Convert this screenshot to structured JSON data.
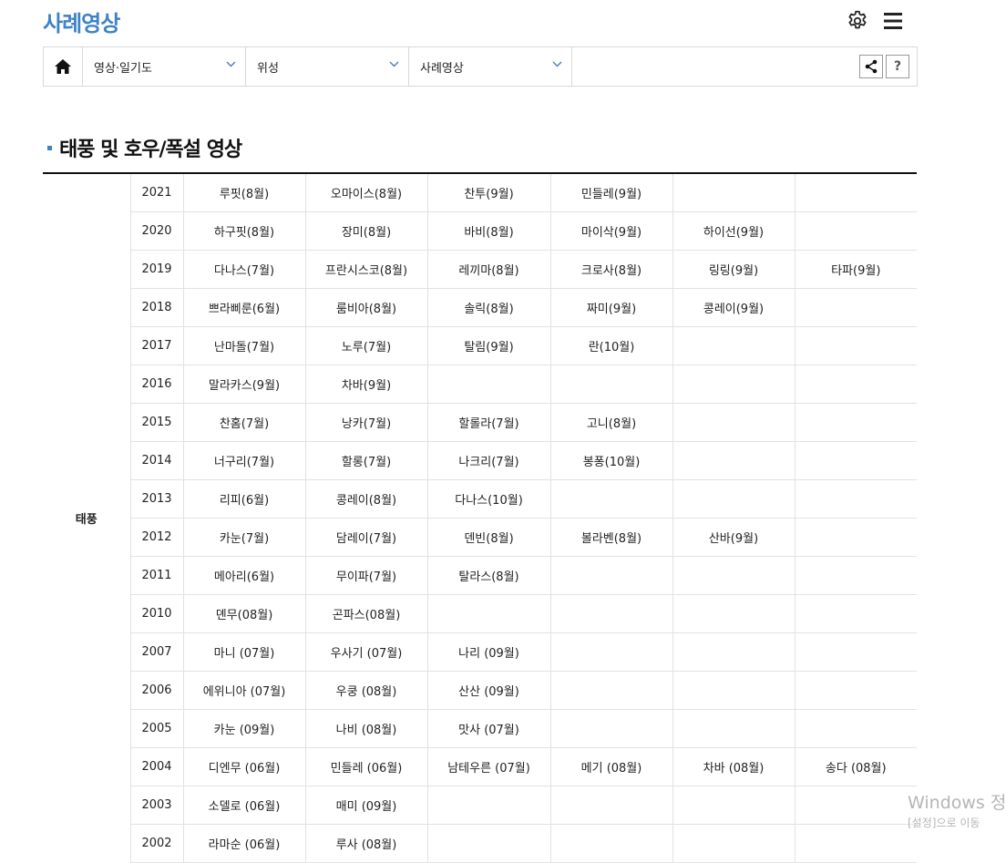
{
  "header": {
    "title": "사례영상"
  },
  "location": {
    "selects": [
      {
        "label": "영상·일기도"
      },
      {
        "label": "위성"
      },
      {
        "label": "사례영상"
      }
    ],
    "help_label": "?"
  },
  "section": {
    "title": "태풍 및 호우/폭설 영상"
  },
  "table": {
    "category": "태풍",
    "rows": [
      {
        "year": "2021",
        "cells": [
          "루핏(8월)",
          "오마이스(8월)",
          "찬투(9월)",
          "민들레(9월)",
          "",
          ""
        ]
      },
      {
        "year": "2020",
        "cells": [
          "하구핏(8월)",
          "장미(8월)",
          "바비(8월)",
          "마이삭(9월)",
          "하이선(9월)",
          ""
        ]
      },
      {
        "year": "2019",
        "cells": [
          "다나스(7월)",
          "프란시스코(8월)",
          "레끼마(8월)",
          "크로사(8월)",
          "링링(9월)",
          "타파(9월)"
        ]
      },
      {
        "year": "2018",
        "cells": [
          "쁘라삐룬(6월)",
          "룸비아(8월)",
          "솔릭(8월)",
          "짜미(9월)",
          "콩레이(9월)",
          ""
        ]
      },
      {
        "year": "2017",
        "cells": [
          "난마돌(7월)",
          "노루(7월)",
          "탈림(9월)",
          "란(10월)",
          "",
          ""
        ]
      },
      {
        "year": "2016",
        "cells": [
          "말라카스(9월)",
          "차바(9월)",
          "",
          "",
          "",
          ""
        ]
      },
      {
        "year": "2015",
        "cells": [
          "찬홈(7월)",
          "낭카(7월)",
          "할롤라(7월)",
          "고니(8월)",
          "",
          ""
        ]
      },
      {
        "year": "2014",
        "cells": [
          "너구리(7월)",
          "할롱(7월)",
          "나크리(7월)",
          "봉퐁(10월)",
          "",
          ""
        ]
      },
      {
        "year": "2013",
        "cells": [
          "리피(6월)",
          "콩레이(8월)",
          "다나스(10월)",
          "",
          "",
          ""
        ]
      },
      {
        "year": "2012",
        "cells": [
          "카눈(7월)",
          "담레이(7월)",
          "덴빈(8월)",
          "볼라벤(8월)",
          "산바(9월)",
          ""
        ]
      },
      {
        "year": "2011",
        "cells": [
          "메아리(6월)",
          "무이파(7월)",
          "탈라스(8월)",
          "",
          "",
          ""
        ]
      },
      {
        "year": "2010",
        "cells": [
          "뎬무(08월)",
          "곤파스(08월)",
          "",
          "",
          "",
          ""
        ]
      },
      {
        "year": "2007",
        "cells": [
          "마니 (07월)",
          "우사기 (07월)",
          "나리 (09월)",
          "",
          "",
          ""
        ]
      },
      {
        "year": "2006",
        "cells": [
          "에위니아 (07월)",
          "우쿵 (08월)",
          "산산 (09월)",
          "",
          "",
          ""
        ]
      },
      {
        "year": "2005",
        "cells": [
          "카눈 (09월)",
          "나비 (08월)",
          "맛사 (07월)",
          "",
          "",
          ""
        ]
      },
      {
        "year": "2004",
        "cells": [
          "디엔무 (06월)",
          "민들레 (06월)",
          "남테우른 (07월)",
          "메기 (08월)",
          "차바 (08월)",
          "송다 (08월)"
        ]
      },
      {
        "year": "2003",
        "cells": [
          "소델로 (06월)",
          "매미 (09월)",
          "",
          "",
          "",
          ""
        ]
      },
      {
        "year": "2002",
        "cells": [
          "라마순 (06월)",
          "루사 (08월)",
          "",
          "",
          "",
          ""
        ]
      }
    ]
  },
  "watermark": {
    "line1": "Windows 정",
    "line2": "[설정]으로 이동"
  },
  "colors": {
    "accent": "#3f83c3",
    "border": "#d9d9d9"
  }
}
